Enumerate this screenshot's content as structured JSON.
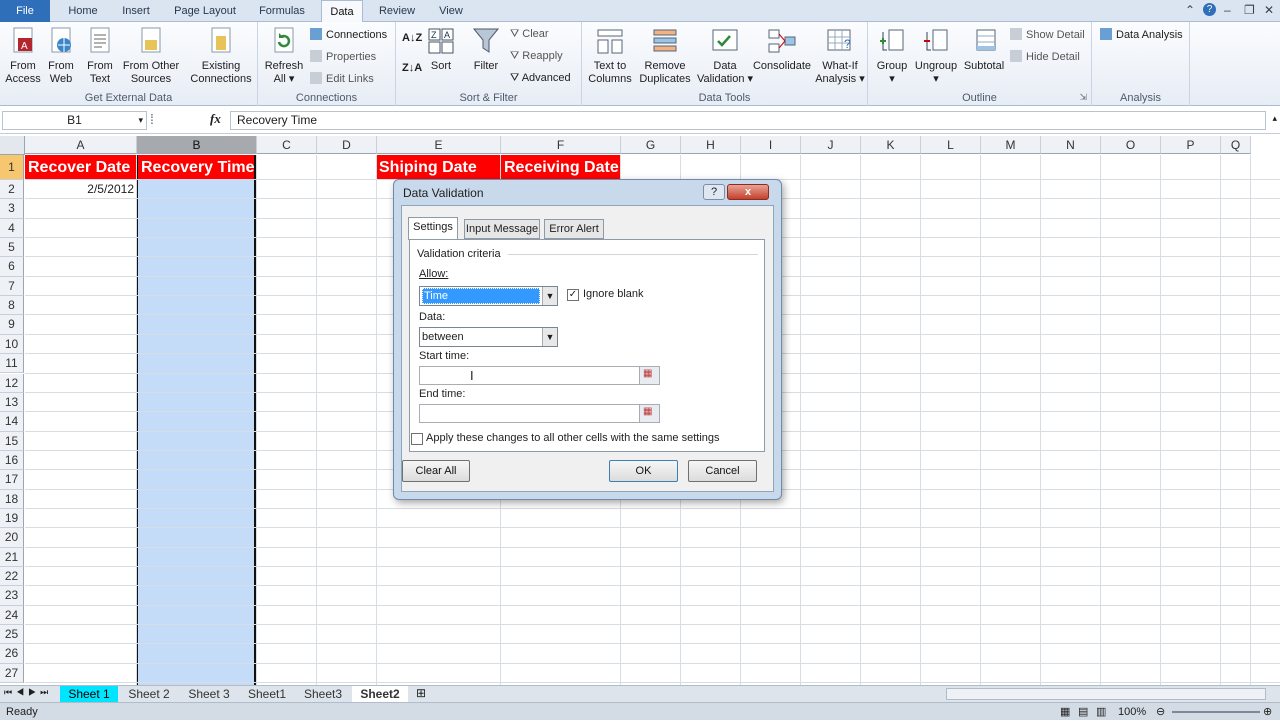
{
  "tabs": {
    "file": "File",
    "home": "Home",
    "insert": "Insert",
    "page_layout": "Page Layout",
    "formulas": "Formulas",
    "data": "Data",
    "review": "Review",
    "view": "View"
  },
  "ribbon": {
    "get_external": {
      "from_access": "From Access",
      "from_web": "From Web",
      "from_text": "From Text",
      "from_other": "From Other Sources",
      "existing": "Existing Connections",
      "label": "Get External Data"
    },
    "connections": {
      "refresh": "Refresh All",
      "connections": "Connections",
      "properties": "Properties",
      "edit_links": "Edit Links",
      "label": "Connections"
    },
    "sort_filter": {
      "sort": "Sort",
      "filter": "Filter",
      "clear": "Clear",
      "reapply": "Reapply",
      "advanced": "Advanced",
      "label": "Sort & Filter"
    },
    "data_tools": {
      "text_to_columns": "Text to Columns",
      "remove_duplicates": "Remove Duplicates",
      "data_validation": "Data Validation",
      "consolidate": "Consolidate",
      "what_if": "What-If Analysis",
      "label": "Data Tools"
    },
    "outline": {
      "group": "Group",
      "ungroup": "Ungroup",
      "subtotal": "Subtotal",
      "show_detail": "Show Detail",
      "hide_detail": "Hide Detail",
      "label": "Outline"
    },
    "analysis": {
      "data_analysis": "Data Analysis",
      "label": "Analysis"
    }
  },
  "formula_bar": {
    "name_box": "B1",
    "fx": "fx",
    "value": "Recovery Time"
  },
  "columns": [
    "A",
    "B",
    "C",
    "D",
    "E",
    "F",
    "G",
    "H",
    "I",
    "J",
    "K",
    "L",
    "M",
    "N",
    "O",
    "P",
    "Q"
  ],
  "rows": [
    "1",
    "2",
    "3",
    "4",
    "5",
    "6",
    "7",
    "8",
    "9",
    "10",
    "11",
    "12",
    "13",
    "14",
    "15",
    "16",
    "17",
    "18",
    "19",
    "20",
    "21",
    "22",
    "23",
    "24",
    "25",
    "26",
    "27"
  ],
  "cells": {
    "A1": "Recover Date",
    "B1": "Recovery Time",
    "E1": "Shiping Date",
    "F1": "Receiving Date",
    "A2": "2/5/2012"
  },
  "sheets": [
    "Sheet 1",
    "Sheet 2",
    "Sheet 3",
    "Sheet1",
    "Sheet3",
    "Sheet2"
  ],
  "status": {
    "ready": "Ready",
    "zoom": "100%"
  },
  "dialog": {
    "title": "Data Validation",
    "help": "?",
    "close": "x",
    "tabs": [
      "Settings",
      "Input Message",
      "Error Alert"
    ],
    "criteria": "Validation criteria",
    "allow_label": "Allow:",
    "allow_value": "Time",
    "ignore_blank": "Ignore blank",
    "data_label": "Data:",
    "data_value": "between",
    "start_label": "Start time:",
    "end_label": "End time:",
    "apply_all": "Apply these changes to all other cells with the same settings",
    "clear_all": "Clear All",
    "ok": "OK",
    "cancel": "Cancel"
  }
}
